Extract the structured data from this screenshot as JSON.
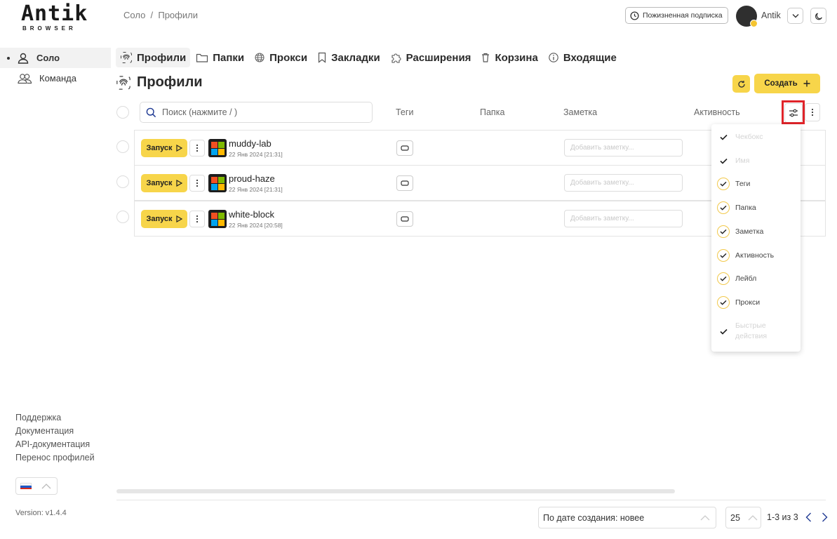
{
  "logo": {
    "main": "Antik",
    "sub": "BROWSER"
  },
  "sidebar": {
    "items": [
      {
        "label": "Соло",
        "active": true
      },
      {
        "label": "Команда",
        "active": false
      }
    ],
    "links": [
      "Поддержка",
      "Документация",
      "API-документация",
      "Перенос профилей"
    ],
    "version": "Version: v1.4.4"
  },
  "header": {
    "breadcrumb": "Соло  /  Профили",
    "subscription": "Пожизненная подписка",
    "username": "Antik"
  },
  "tabs": [
    {
      "label": "Профили",
      "icon": "fingerprint-icon",
      "active": true
    },
    {
      "label": "Папки",
      "icon": "folder-icon",
      "active": false
    },
    {
      "label": "Прокси",
      "icon": "globe-icon",
      "active": false
    },
    {
      "label": "Закладки",
      "icon": "bookmark-icon",
      "active": false
    },
    {
      "label": "Расширения",
      "icon": "puzzle-icon",
      "active": false
    },
    {
      "label": "Корзина",
      "icon": "trash-icon",
      "active": false
    },
    {
      "label": "Входящие",
      "icon": "info-icon",
      "active": false
    }
  ],
  "page": {
    "title": "Профили",
    "create_label": "Создать"
  },
  "table": {
    "search_placeholder": "Поиск (нажмите / )",
    "columns": {
      "tags": "Теги",
      "folder": "Папка",
      "note": "Заметка",
      "activity": "Активность"
    },
    "launch_label": "Запуск",
    "note_placeholder": "Добавить заметку...",
    "rows": [
      {
        "name": "muddy-lab",
        "date": "22 Янв 2024 [21:31]"
      },
      {
        "name": "proud-haze",
        "date": "22 Янв 2024 [21:31]"
      },
      {
        "name": "white-block",
        "date": "22 Янв 2024 [20:58]"
      }
    ]
  },
  "column_menu": [
    {
      "label": "Чекбокс",
      "checked": true,
      "disabled": true
    },
    {
      "label": "Имя",
      "checked": true,
      "disabled": true
    },
    {
      "label": "Теги",
      "checked": true,
      "disabled": false
    },
    {
      "label": "Папка",
      "checked": true,
      "disabled": false
    },
    {
      "label": "Заметка",
      "checked": true,
      "disabled": false
    },
    {
      "label": "Активность",
      "checked": true,
      "disabled": false
    },
    {
      "label": "Лейбл",
      "checked": true,
      "disabled": false
    },
    {
      "label": "Прокси",
      "checked": true,
      "disabled": false
    },
    {
      "label": "Быстрые действия",
      "checked": true,
      "disabled": true
    }
  ],
  "footer": {
    "sort": "По дате создания: новее",
    "per_page": "25",
    "page_info": "1-3 из 3"
  },
  "colors": {
    "accent": "#f7d54a",
    "highlight": "#e0242a"
  }
}
